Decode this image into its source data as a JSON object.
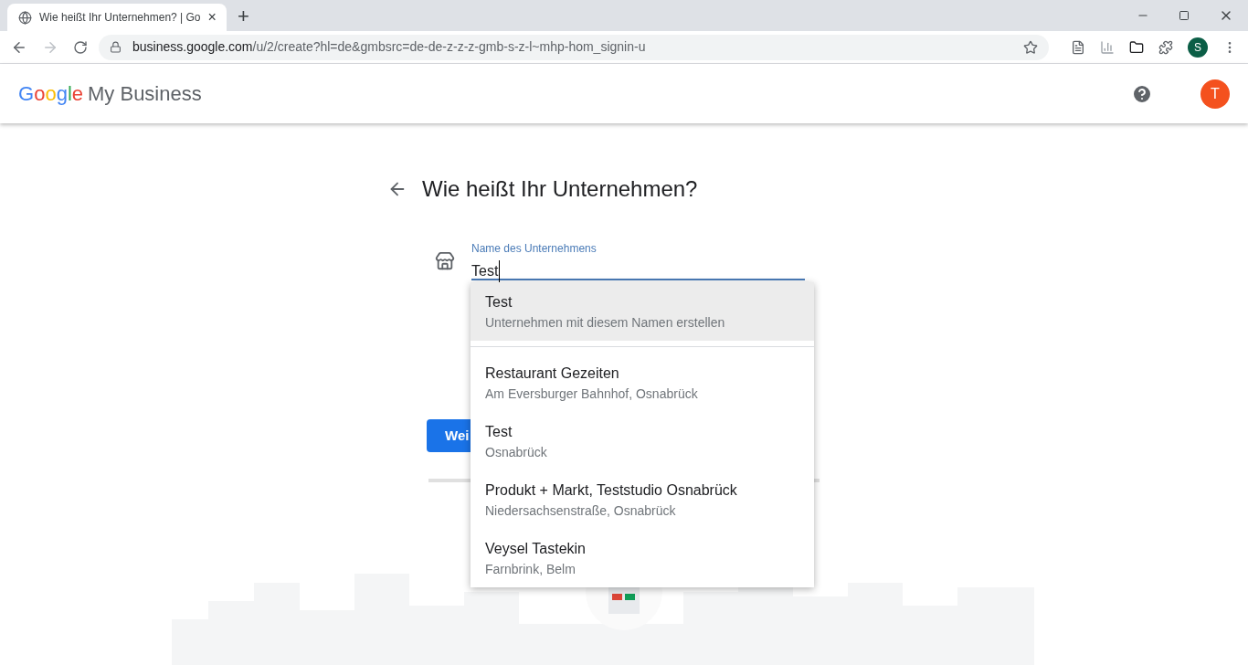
{
  "browser": {
    "tab_title": "Wie heißt Ihr Unternehmen? | Go",
    "tab_close": "×",
    "new_tab": "+",
    "url_host": "business.google.com",
    "url_path": "/u/2/create?hl=de&gmbsrc=de-de-z-z-z-gmb-s-z-l~mhp-hom_signin-u",
    "profile_initial": "S"
  },
  "header": {
    "logo_letters": [
      {
        "char": "G",
        "color": "#4285f4"
      },
      {
        "char": "o",
        "color": "#ea4335"
      },
      {
        "char": "o",
        "color": "#fbbc05"
      },
      {
        "char": "g",
        "color": "#4285f4"
      },
      {
        "char": "l",
        "color": "#34a853"
      },
      {
        "char": "e",
        "color": "#ea4335"
      }
    ],
    "product": "My Business",
    "account_initial": "T"
  },
  "page": {
    "title": "Wie heißt Ihr Unternehmen?",
    "field": {
      "label": "Name des Unternehmens",
      "value": "Test",
      "focused": true
    },
    "next_button": "Wei"
  },
  "dropdown": {
    "create_option": {
      "title": "Test",
      "subtitle": "Unternehmen mit diesem Namen erstellen",
      "selected": true
    },
    "suggestions": [
      {
        "title": "Restaurant Gezeiten",
        "subtitle": "Am Eversburger Bahnhof, Osnabrück",
        "selected": false
      },
      {
        "title": "Test",
        "subtitle": "Osnabrück",
        "selected": false
      },
      {
        "title": "Produkt + Markt, Teststudio Osnabrück",
        "subtitle": "Niedersachsenstraße, Osnabrück",
        "selected": false
      },
      {
        "title": "Veysel Tastekin",
        "subtitle": "Farnbrink, Belm",
        "selected": false
      }
    ]
  }
}
